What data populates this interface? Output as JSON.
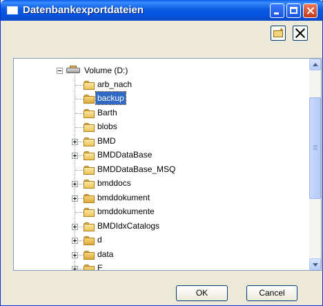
{
  "window": {
    "title": "Datenbankexportdateien"
  },
  "toolbar": {
    "new_folder_icon": "new-folder-icon",
    "delete_icon": "delete-icon"
  },
  "tree": {
    "root": {
      "label": "Volume (D:)",
      "icon": "drive-icon",
      "expanded": true
    },
    "items": [
      {
        "label": "arb_nach",
        "expander": "none",
        "icon": "folder-icon",
        "selected": false
      },
      {
        "label": "backup",
        "expander": "none",
        "icon": "folder-open-icon",
        "selected": true
      },
      {
        "label": "Barth",
        "expander": "none",
        "icon": "folder-icon",
        "selected": false
      },
      {
        "label": "blobs",
        "expander": "none",
        "icon": "folder-icon",
        "selected": false
      },
      {
        "label": "BMD",
        "expander": "plus",
        "icon": "folder-icon",
        "selected": false
      },
      {
        "label": "BMDDataBase",
        "expander": "plus",
        "icon": "folder-icon",
        "selected": false
      },
      {
        "label": "BMDDataBase_MSQ",
        "expander": "none",
        "icon": "folder-icon",
        "selected": false
      },
      {
        "label": "bmddocs",
        "expander": "plus",
        "icon": "folder-icon",
        "selected": false
      },
      {
        "label": "bmddokument",
        "expander": "plus",
        "icon": "folder-open-icon",
        "selected": false
      },
      {
        "label": "bmddokumente",
        "expander": "none",
        "icon": "folder-icon",
        "selected": false
      },
      {
        "label": "BMDIdxCatalogs",
        "expander": "plus",
        "icon": "folder-icon",
        "selected": false
      },
      {
        "label": "d",
        "expander": "plus",
        "icon": "folder-open-icon",
        "selected": false
      },
      {
        "label": "data",
        "expander": "plus",
        "icon": "folder-open-icon",
        "selected": false
      },
      {
        "label": "E",
        "expander": "plus",
        "icon": "folder-open-icon",
        "selected": false
      }
    ]
  },
  "buttons": {
    "ok": "OK",
    "cancel": "Cancel"
  }
}
